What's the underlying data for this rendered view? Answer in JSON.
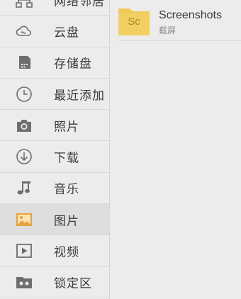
{
  "sidebar": {
    "items": [
      {
        "label": "网络邻居",
        "icon": "network-icon"
      },
      {
        "label": "云盘",
        "icon": "cloud-icon"
      },
      {
        "label": "存储盘",
        "icon": "storage-icon"
      },
      {
        "label": "最近添加",
        "icon": "clock-icon"
      },
      {
        "label": "照片",
        "icon": "camera-icon"
      },
      {
        "label": "下载",
        "icon": "download-icon"
      },
      {
        "label": "音乐",
        "icon": "music-icon"
      },
      {
        "label": "图片",
        "icon": "image-icon",
        "active": true
      },
      {
        "label": "视频",
        "icon": "video-icon"
      },
      {
        "label": "锁定区",
        "icon": "lock-folder-icon"
      }
    ]
  },
  "main": {
    "folder": {
      "abbr": "Sc",
      "name": "Screenshots",
      "subtitle": "截屏"
    }
  },
  "colors": {
    "folder": "#f0c955",
    "active_icon": "#e8a23a",
    "icon_gray": "#6e6e6e"
  }
}
